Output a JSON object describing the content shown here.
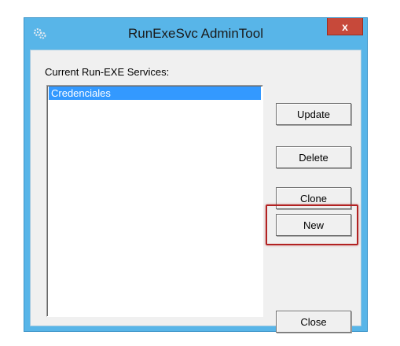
{
  "window": {
    "title": "RunExeSvc AdminTool",
    "close_label": "x"
  },
  "services": {
    "label": "Current Run-EXE Services:",
    "items": [
      "Credenciales"
    ],
    "selected_index": 0
  },
  "buttons": {
    "update": "Update",
    "delete": "Delete",
    "clone": "Clone",
    "new": "New",
    "close": "Close"
  },
  "annotation": {
    "highlight_target": "New",
    "color": "#b22222"
  },
  "colors": {
    "title_bar": "#58b5e8",
    "close_button": "#c7493a",
    "selection": "#3399ff"
  }
}
